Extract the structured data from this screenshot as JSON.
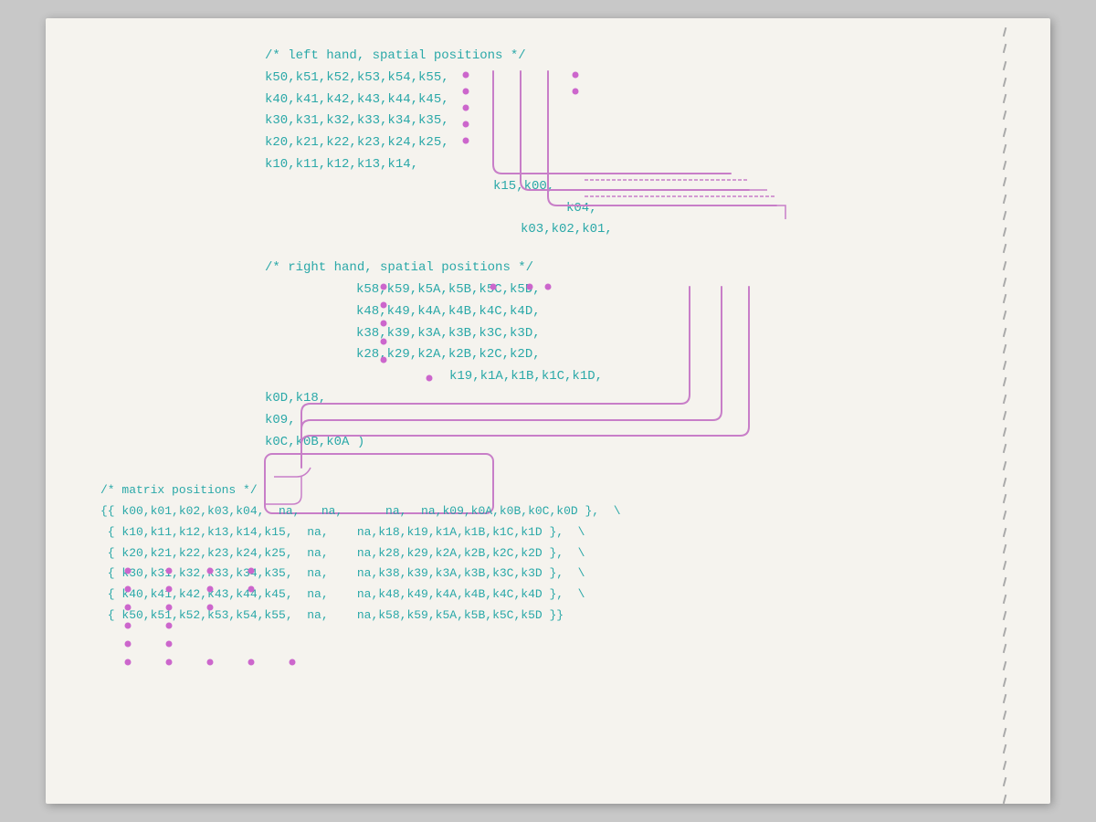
{
  "page": {
    "background": "#f5f3ee",
    "left_hand_comment": "/* left hand, spatial positions */",
    "left_hand_lines": [
      "k50,k51,k52,k53,k54,k55,",
      "k40,k41,k42,k43,k44,k45,",
      "k30,k31,k32,k33,k34,k35,",
      "k20,k21,k22,k23,k24,k25,",
      "k10,k11,k12,k13,k14,"
    ],
    "left_hand_continuation": [
      "                                k15,k00,",
      "                                     k04,",
      "                                k03,k02,k01,"
    ],
    "right_hand_comment": "/* right hand, spatial positions */",
    "right_hand_lines": [
      "k58,k59,k5A,k5B,k5C,k5D,",
      "k48,k49,k4A,k4B,k4C,k4D,",
      "k38,k39,k3A,k3B,k3C,k3D,",
      "k28,k29,k2A,k2B,k2C,k2D,",
      "          k19,k1A,k1B,k1C,k1D,"
    ],
    "right_hand_extra": [
      "k0D,k18,",
      "k09,",
      "k0C,k0B,k0A )"
    ],
    "matrix_comment": "/* matrix positions */",
    "matrix_lines": [
      "{{ k00,k01,k02,k03,k04, na,  na,    na, na,k09,k0A,k0B,k0C,k0D },",
      " { k10,k11,k12,k13,k14,k15, na,  na,k18,k19,k1A,k1B,k1C,k1D },",
      " { k20,k21,k22,k23,k24,k25, na,  na,k28,k29,k2A,k2B,k2C,k2D },",
      " { k30,k31,k32,k33,k34,k35, na,  na,k38,k39,k3A,k3B,k3C,k3D },",
      " { k40,k41,k42,k43,k44,k45, na,  na,k48,k49,k4A,k4B,k4C,k4D },",
      " { k50,k51,k52,k53,k54,k55, na,  na,k58,k59,k5A,k5B,k5C,k5D }}"
    ]
  }
}
